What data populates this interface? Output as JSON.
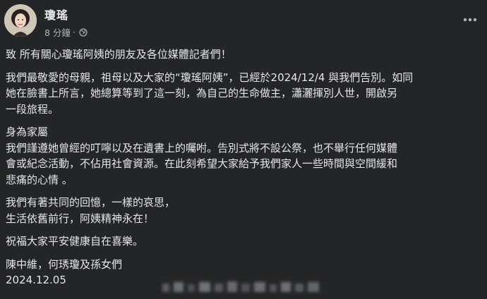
{
  "author": {
    "name": "瓊瑤",
    "time": "8 分鐘",
    "separator": "·",
    "audience_icon": "globe-icon"
  },
  "menu": {
    "icon": "more-dots-icon"
  },
  "post": {
    "greeting": "致 所有關心瓊瑤阿姨的朋友及各位媒體記者們！",
    "p1": [
      "我們最敬愛的母親，祖母以及大家的“瓊瑤阿姨”，已經於2024/12/4 與我們告別。如同",
      "她在臉書上所言，她總算等到了這一刻，為自己的生命做主，瀟灑揮別人世，開啟另",
      "一段旅程。"
    ],
    "p2": [
      "身為家屬",
      "我們謹遵她曾經的叮嚀以及在遺書上的囑咐。告別式將不設公祭，也不舉行任何媒體",
      "會或紀念活動，不佔用社會資源。在此刻希望大家給予我們家人一些時間與空間緩和",
      "悲痛的心情 。"
    ],
    "p3": [
      "我們有著共同的回憶，一樣的哀思，",
      "生活依舊前行，阿姨精神永在！"
    ],
    "p4": "祝福大家平安健康自在喜樂。",
    "signature": "陳中維，何琇瓊及孫女們",
    "date": "2024.12.05"
  },
  "colors": {
    "background": "#242526",
    "text_primary": "#e4e6eb",
    "text_secondary": "#b0b3b8"
  }
}
